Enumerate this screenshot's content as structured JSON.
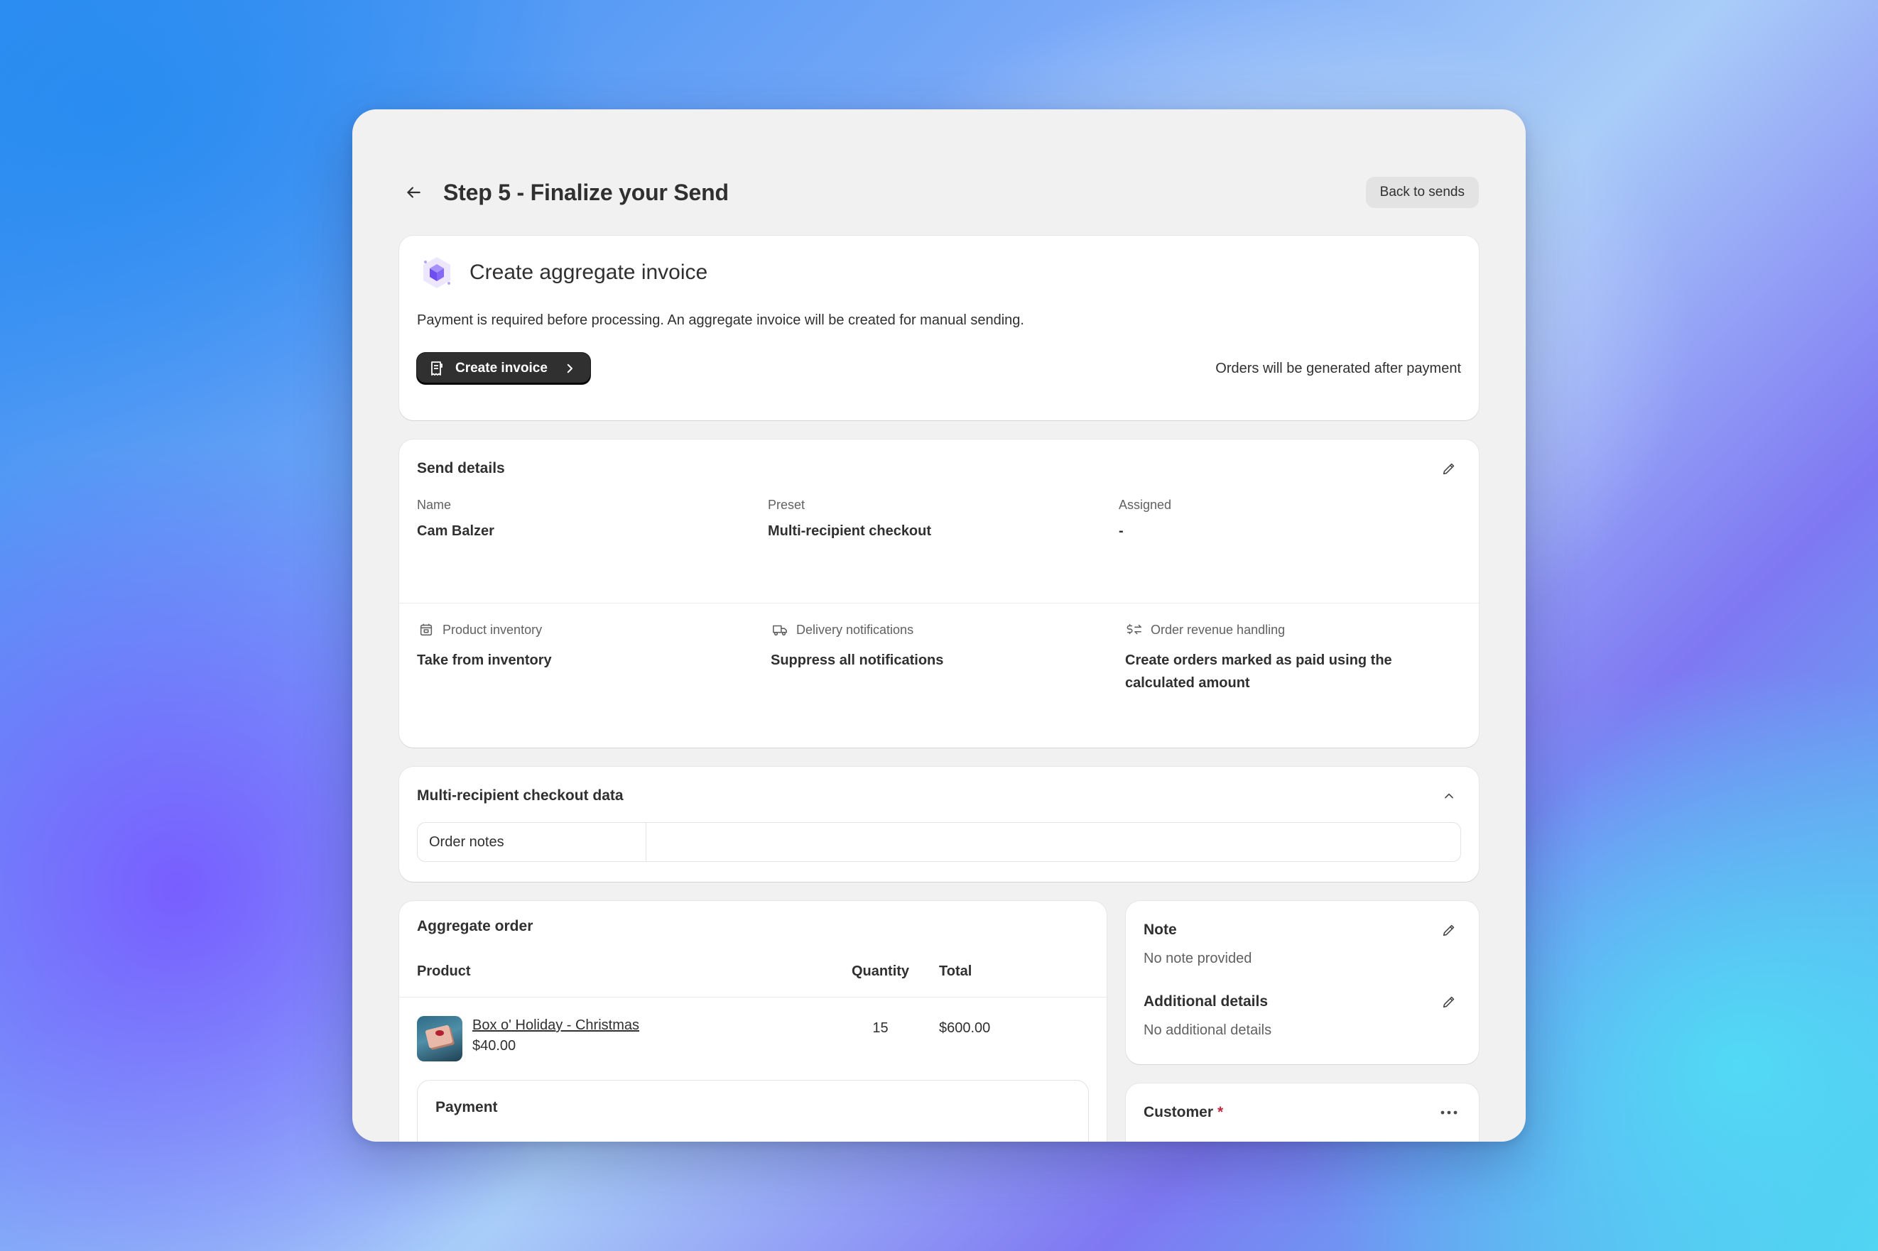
{
  "header": {
    "title": "Step 5 - Finalize your Send",
    "back_button": "Back to sends"
  },
  "invoice": {
    "title": "Create aggregate invoice",
    "description": "Payment is required before processing. An aggregate invoice will be created for manual sending.",
    "button_label": "Create invoice",
    "note": "Orders will be generated after payment"
  },
  "send_details": {
    "title": "Send details",
    "fields": [
      {
        "label": "Name",
        "value": "Cam Balzer"
      },
      {
        "label": "Preset",
        "value": "Multi-recipient checkout"
      },
      {
        "label": "Assigned",
        "value": "-"
      }
    ],
    "settings": [
      {
        "label": "Product inventory",
        "value": "Take from inventory",
        "icon": "inventory-icon"
      },
      {
        "label": "Delivery notifications",
        "value": "Suppress all notifications",
        "icon": "truck-icon"
      },
      {
        "label": "Order revenue handling",
        "value": "Create orders marked as paid using the calculated amount",
        "icon": "dollar-exchange-icon"
      }
    ]
  },
  "checkout_data": {
    "title": "Multi-recipient checkout data",
    "order_notes_label": "Order notes",
    "order_notes_value": ""
  },
  "aggregate_order": {
    "title": "Aggregate order",
    "columns": [
      "Product",
      "Quantity",
      "Total"
    ],
    "rows": [
      {
        "name": "Box o' Holiday - Christmas",
        "price": "$40.00",
        "quantity": "15",
        "total": "$600.00"
      }
    ],
    "payment_title": "Payment"
  },
  "note_card": {
    "note_title": "Note",
    "note_value": "No note provided",
    "additional_title": "Additional details",
    "additional_value": "No additional details"
  },
  "customer_card": {
    "title": "Customer",
    "required_mark": "*"
  },
  "colors": {
    "primary_button": "#303030",
    "accent_purple": "#7b5cf5",
    "required": "#c5283d"
  }
}
